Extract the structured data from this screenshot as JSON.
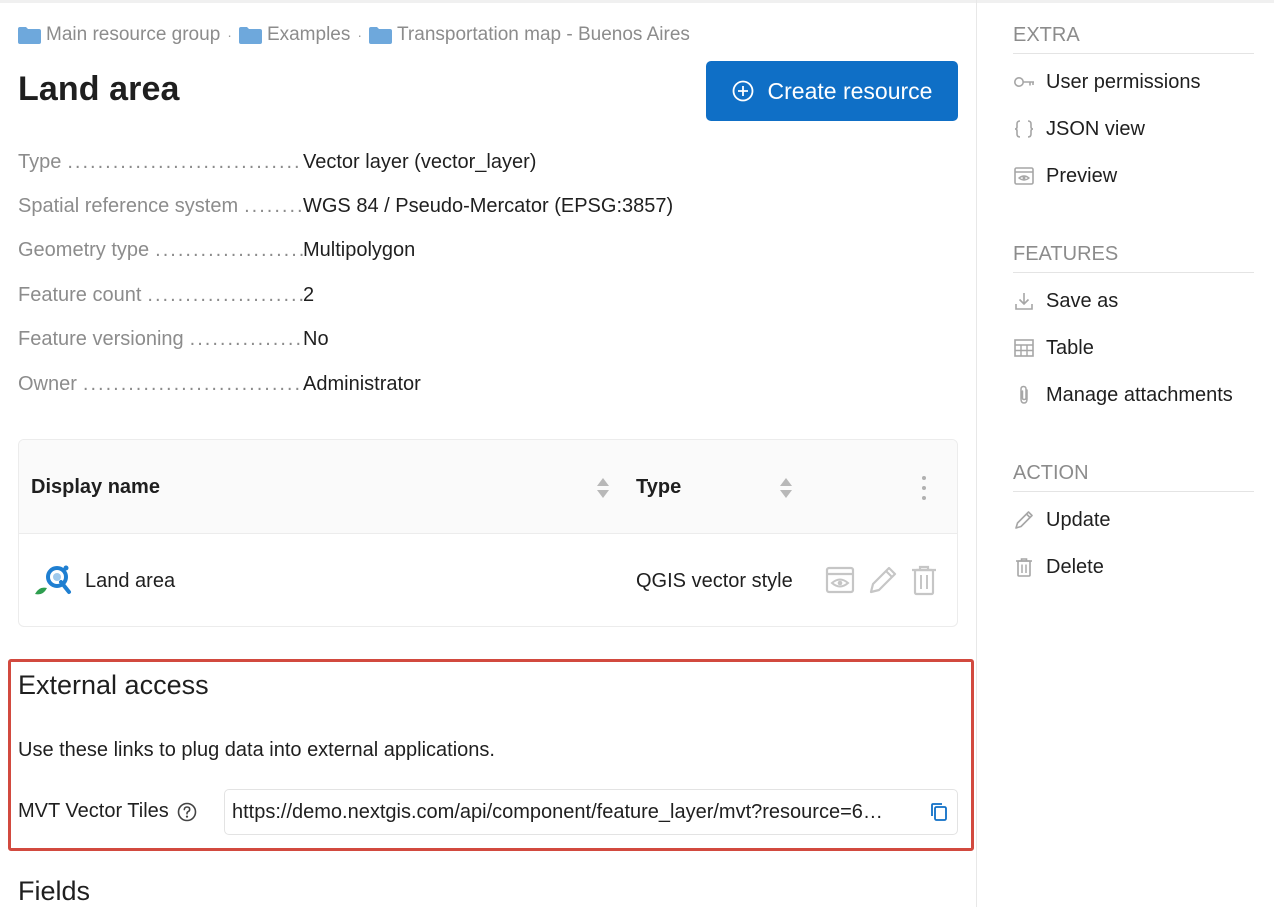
{
  "breadcrumb": {
    "items": [
      "Main resource group",
      "Examples",
      "Transportation map - Buenos Aires"
    ],
    "separator": "·"
  },
  "page": {
    "title": "Land area",
    "create_button": "Create resource"
  },
  "properties": [
    {
      "label": "Type",
      "value": "Vector layer (vector_layer)"
    },
    {
      "label": "Spatial reference system",
      "value": "WGS 84 / Pseudo-Mercator (EPSG:3857)"
    },
    {
      "label": "Geometry type",
      "value": "Multipolygon"
    },
    {
      "label": "Feature count",
      "value": "2"
    },
    {
      "label": "Feature versioning",
      "value": "No"
    },
    {
      "label": "Owner",
      "value": "Administrator"
    }
  ],
  "children_table": {
    "columns": [
      "Display name",
      "Type"
    ],
    "rows": [
      {
        "name": "Land area",
        "type": "QGIS vector style"
      }
    ]
  },
  "external_access": {
    "title": "External access",
    "description": "Use these links to plug data into external applications.",
    "mvt_label": "MVT Vector Tiles",
    "mvt_url": "https://demo.nextgis.com/api/component/feature_layer/mvt?resource=6…"
  },
  "fields_title": "Fields",
  "sidebar": {
    "sections": [
      {
        "title": "EXTRA",
        "items": [
          {
            "label": "User permissions",
            "icon": "key-icon"
          },
          {
            "label": "JSON view",
            "icon": "braces-icon"
          },
          {
            "label": "Preview",
            "icon": "preview-icon"
          }
        ]
      },
      {
        "title": "FEATURES",
        "items": [
          {
            "label": "Save as",
            "icon": "download-icon"
          },
          {
            "label": "Table",
            "icon": "table-icon"
          },
          {
            "label": "Manage attachments",
            "icon": "paperclip-icon"
          }
        ]
      },
      {
        "title": "ACTION",
        "items": [
          {
            "label": "Update",
            "icon": "pencil-icon"
          },
          {
            "label": "Delete",
            "icon": "trash-icon"
          }
        ]
      }
    ]
  },
  "colors": {
    "primary": "#0f6fc6",
    "highlight_border": "#d24a3f",
    "muted_text": "#8c8c8c",
    "folder": "#6ea8dc"
  }
}
